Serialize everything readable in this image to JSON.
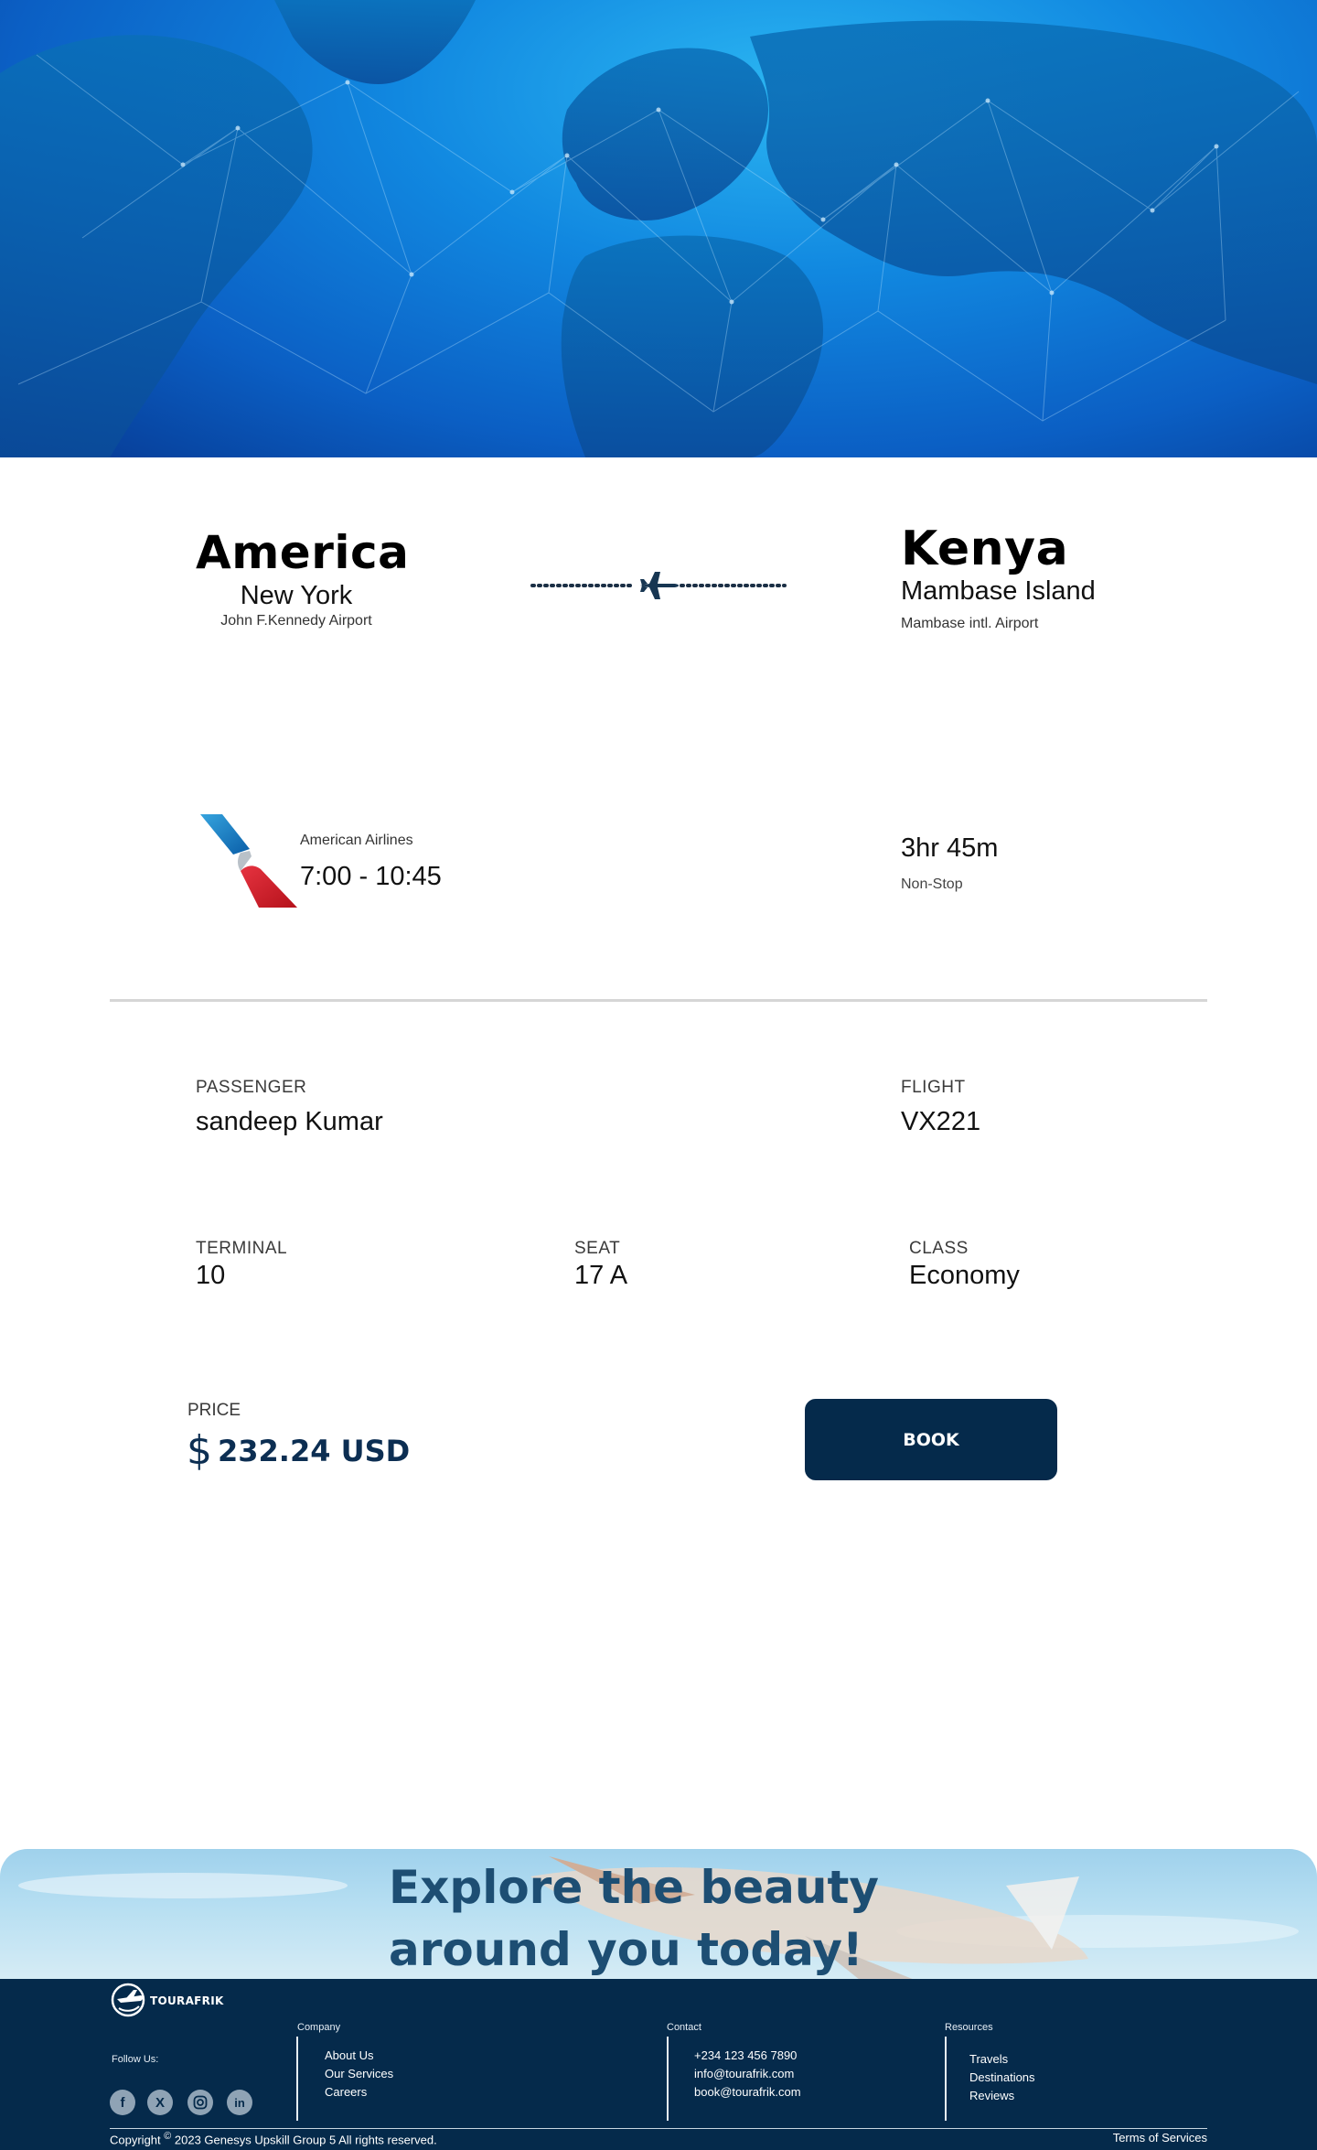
{
  "route": {
    "from": {
      "country": "America",
      "city": "New York",
      "airport": "John F.Kennedy Airport"
    },
    "to": {
      "country": "Kenya",
      "city": "Mambase Island",
      "airport": "Mambase intl. Airport"
    }
  },
  "flight": {
    "airline": "American Airlines",
    "time": "7:00 - 10:45",
    "duration": "3hr 45m",
    "stops": "Non-Stop"
  },
  "details": {
    "passenger_label": "PASSENGER",
    "passenger_value": "sandeep Kumar",
    "flight_label": "FLIGHT",
    "flight_value": "VX221",
    "terminal_label": "TERMINAL",
    "terminal_value": "10",
    "seat_label": "SEAT",
    "seat_value": "17 A",
    "class_label": "CLASS",
    "class_value": "Economy"
  },
  "price": {
    "label": "PRICE",
    "currency_symbol": "$",
    "amount": "232.24 USD"
  },
  "book_label": "BOOK",
  "banner": {
    "line1": "Explore the beauty",
    "line2": "around you today!"
  },
  "footer": {
    "brand": "TOURAFRIK",
    "follow_label": "Follow Us:",
    "socials": [
      "facebook-icon",
      "x-icon",
      "instagram-icon",
      "linkedin-icon"
    ],
    "company": {
      "heading": "Company",
      "links": [
        "About Us",
        "Our Services",
        "Careers"
      ]
    },
    "contact": {
      "heading": "Contact",
      "links": [
        "+234 123 456 7890",
        "info@tourafrik.com",
        "book@tourafrik.com"
      ]
    },
    "resources": {
      "heading": "Resources",
      "links": [
        "Travels",
        "Destinations",
        "Reviews"
      ]
    },
    "copyright_prefix": "Copyright",
    "copyright_symbol": "©",
    "copyright_text": "2023 Genesys Upskill Group 5 All rights reserved.",
    "terms": "Terms of Services"
  },
  "colors": {
    "primary": "#052a4b",
    "accent_blue": "#1d4e73",
    "hero_blue": "#1188e0"
  }
}
